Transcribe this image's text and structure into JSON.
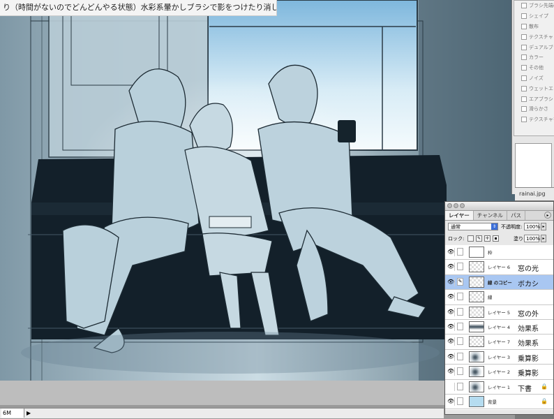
{
  "caption": {
    "text": "り（時間がないのでどんどんやる状態）水彩系暈かしブラシで影をつけたり消したり"
  },
  "status_bar": {
    "zoom": "6M",
    "arrow": "▶"
  },
  "brush_panel": {
    "items": [
      "ブラシ先端のシェ",
      "シェイプ",
      "散布",
      "テクスチャ",
      "デュアルブラシ",
      "カラー",
      "その他",
      "ノイズ",
      "ウェットエッジ",
      "エアブラシ",
      "滑らかさ",
      "テクスチャを保"
    ]
  },
  "document_tab": {
    "label": "rainai.jpg"
  },
  "layers_panel": {
    "tabs": [
      "レイヤー",
      "チャンネル",
      "パス"
    ],
    "menu_icon": "▸",
    "blend_mode": "通常",
    "opacity_label": "不透明度:",
    "opacity_value": "100%",
    "lock_label": "ロック:",
    "fill_label": "塗り:",
    "fill_value": "100%",
    "layers": [
      {
        "name": "枠",
        "note": "",
        "visible": true,
        "thumb": "white",
        "selected": false,
        "locked": false
      },
      {
        "name": "レイヤー 6",
        "note": "窓の光",
        "visible": true,
        "thumb": "checker",
        "selected": false,
        "locked": false
      },
      {
        "name": "線 のコピー",
        "note": "ボカシ",
        "visible": true,
        "thumb": "checker",
        "selected": true,
        "locked": false
      },
      {
        "name": "線",
        "note": "",
        "visible": true,
        "thumb": "checker",
        "selected": false,
        "locked": false
      },
      {
        "name": "レイヤー 5",
        "note": "窓の外",
        "visible": true,
        "thumb": "checker",
        "selected": false,
        "locked": false
      },
      {
        "name": "レイヤー 4",
        "note": "効果系",
        "visible": true,
        "thumb": "dark",
        "selected": false,
        "locked": false
      },
      {
        "name": "レイヤー 7",
        "note": "効果系",
        "visible": true,
        "thumb": "checker",
        "selected": false,
        "locked": false
      },
      {
        "name": "レイヤー 3",
        "note": "乗算影",
        "visible": true,
        "thumb": "sketch",
        "selected": false,
        "locked": false
      },
      {
        "name": "レイヤー 2",
        "note": "乗算影",
        "visible": true,
        "thumb": "sketch",
        "selected": false,
        "locked": false
      },
      {
        "name": "レイヤー 1",
        "note": "下書",
        "visible": false,
        "thumb": "sketch",
        "selected": false,
        "locked": true
      },
      {
        "name": "背景",
        "note": "",
        "visible": true,
        "thumb": "blue",
        "selected": false,
        "locked": true
      }
    ]
  },
  "colors": {
    "artwork_tint": "#a9c6d3",
    "sofa": "#13202a",
    "selected_layer": "#a9c7f2",
    "canvas_surround": "#bdbdbd"
  }
}
